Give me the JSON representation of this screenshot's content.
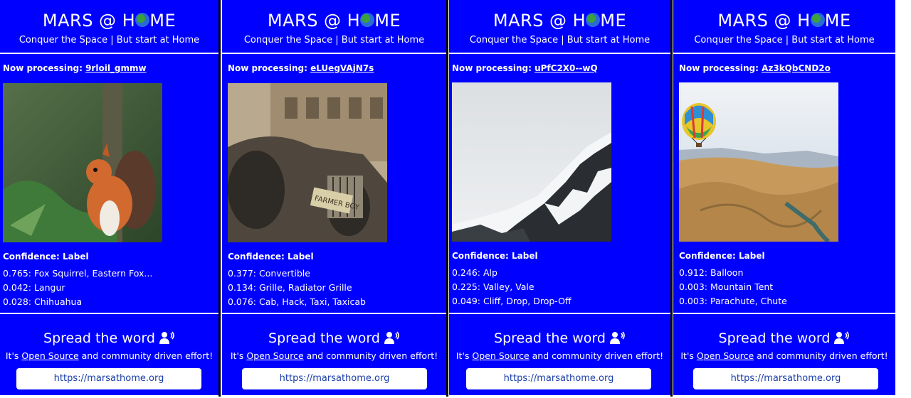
{
  "header": {
    "title_left": "MARS @ H",
    "title_right": "ME",
    "subtitle": "Conquer the Space | But start at Home"
  },
  "labels": {
    "now_processing": "Now processing:",
    "confidence_label": "Confidence: Label",
    "spread_word": "Spread the word",
    "open_source_prefix": "It's ",
    "open_source_link": "Open Source",
    "open_source_suffix": " and community driven effort!",
    "url": "https://marsathome.org"
  },
  "panels": [
    {
      "id": "9rloil_gmmw",
      "image": "squirrel-photo",
      "preds": [
        "0.765: Fox Squirrel, Eastern Fox...",
        "0.042: Langur",
        "0.028: Chihuahua"
      ]
    },
    {
      "id": "eLUegVAjN7s",
      "image": "vintage-car-photo",
      "preds": [
        "0.377: Convertible",
        "0.134: Grille, Radiator Grille",
        "0.076: Cab, Hack, Taxi, Taxicab"
      ]
    },
    {
      "id": "uPfC2X0--wQ",
      "image": "snowy-mountain-photo",
      "preds": [
        "0.246: Alp",
        "0.225: Valley, Vale",
        "0.049: Cliff, Drop, Drop-Off"
      ]
    },
    {
      "id": "Az3kQbCND2o",
      "image": "hot-air-balloon-photo",
      "preds": [
        "0.912: Balloon",
        "0.003: Mountain Tent",
        "0.003: Parachute, Chute"
      ]
    }
  ],
  "colors": {
    "panel_bg": "#0000ff",
    "text": "#ffffff",
    "button_text": "#1a3ea8"
  }
}
